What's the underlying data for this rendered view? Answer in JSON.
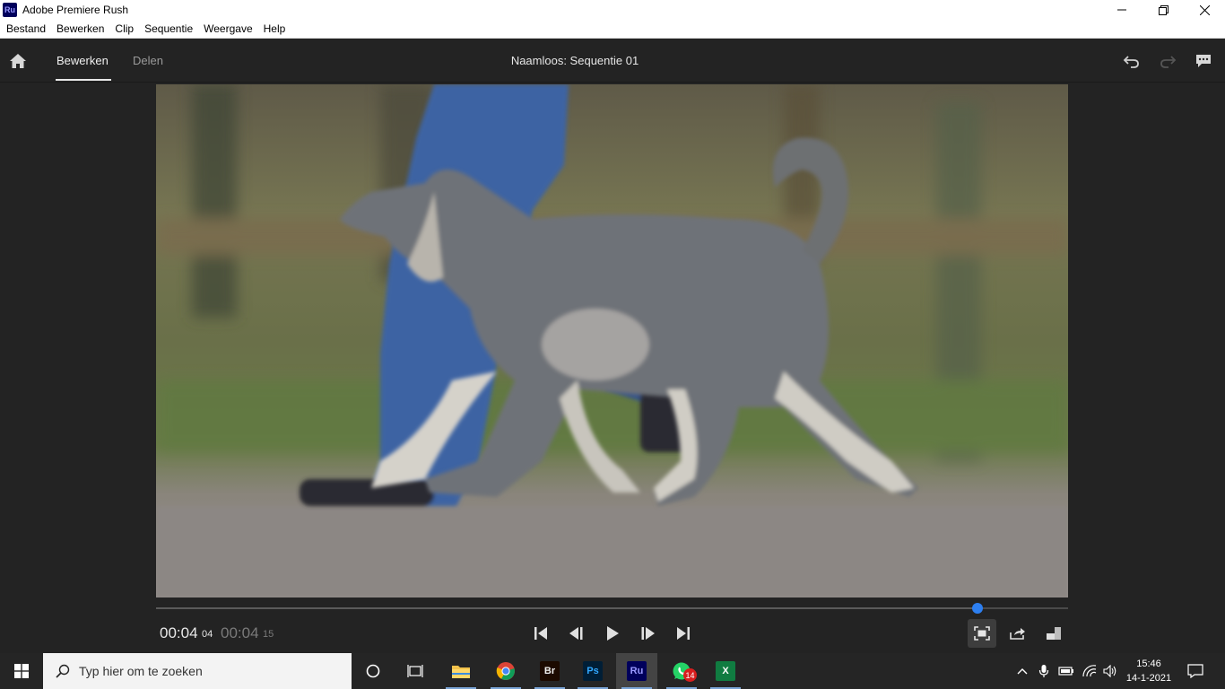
{
  "window": {
    "app_badge": "Ru",
    "title": "Adobe Premiere Rush",
    "controls": [
      "minimize",
      "restore",
      "close"
    ]
  },
  "menubar": {
    "items": [
      "Bestand",
      "Bewerken",
      "Clip",
      "Sequentie",
      "Weergave",
      "Help"
    ]
  },
  "header": {
    "tabs": [
      {
        "label": "Bewerken",
        "active": true
      },
      {
        "label": "Delen",
        "active": false
      }
    ],
    "sequence_title": "Naamloos: Sequentie 01",
    "icons": [
      "home-icon",
      "undo-icon",
      "redo-icon",
      "comment-icon"
    ]
  },
  "player": {
    "progress": 0.901,
    "current_time": "00:04",
    "current_frames": "04",
    "total_time": "00:04",
    "total_frames": "15",
    "controls": [
      "go-to-start",
      "step-back",
      "play",
      "step-forward",
      "go-to-end"
    ],
    "right_controls": [
      "fit-view",
      "export-frame",
      "aspect-ratio"
    ],
    "accent": "#2d7ff0"
  },
  "taskbar": {
    "search_placeholder": "Typ hier om te zoeken",
    "apps": [
      {
        "name": "file-explorer",
        "label": ""
      },
      {
        "name": "chrome",
        "label": ""
      },
      {
        "name": "bridge",
        "label": "Br"
      },
      {
        "name": "photoshop",
        "label": "Ps"
      },
      {
        "name": "premiere-rush",
        "label": "Ru"
      },
      {
        "name": "whatsapp",
        "label": "",
        "badge": "14"
      },
      {
        "name": "excel",
        "label": "X"
      }
    ],
    "time": "15:46",
    "date": "14-1-2021"
  }
}
